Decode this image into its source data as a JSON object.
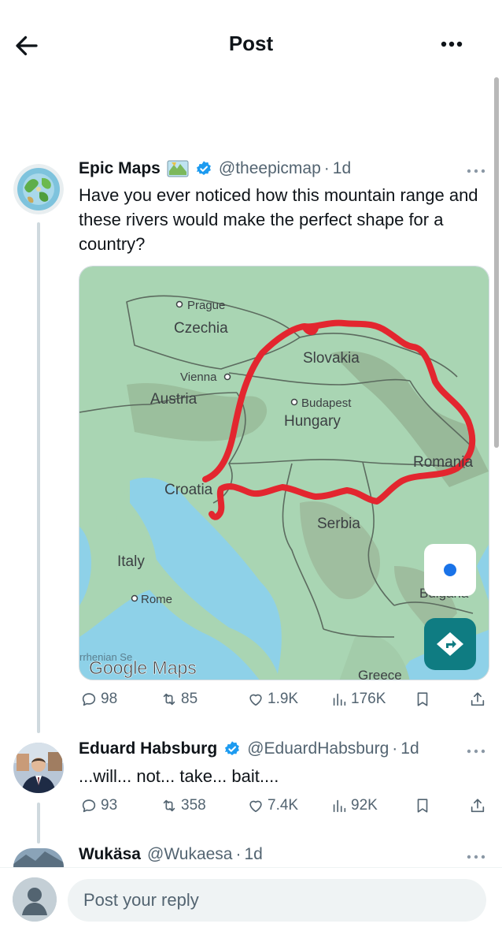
{
  "header": {
    "title": "Post"
  },
  "posts": [
    {
      "name": "Epic Maps",
      "handle": "@theepicmap",
      "separator": "·",
      "time": "1d",
      "text": "Have you ever noticed how this mountain range and these rivers would make the perfect shape for a country?",
      "media": {
        "labels": {
          "prague": "Prague",
          "czechia": "Czechia",
          "vienna": "Vienna",
          "austria": "Austria",
          "slovakia": "Slovakia",
          "budapest": "Budapest",
          "hungary": "Hungary",
          "romania": "Romania",
          "croatia": "Croatia",
          "serbia": "Serbia",
          "italy": "Italy",
          "rome": "Rome",
          "tyrrhenian": "rrhenian Se",
          "bulgaria": "Bulgaria",
          "greece": "Greece",
          "attribution": "Google Maps"
        }
      },
      "stats": {
        "replies": "98",
        "reposts": "85",
        "likes": "1.9K",
        "views": "176K"
      }
    },
    {
      "name": "Eduard Habsburg",
      "handle": "@EduardHabsburg",
      "separator": "·",
      "time": "1d",
      "text": "...will... not... take... bait....",
      "stats": {
        "replies": "93",
        "reposts": "358",
        "likes": "7.4K",
        "views": "92K"
      }
    },
    {
      "name": "Wukäsa",
      "handle": "@Wukaesa",
      "separator": "·",
      "time": "1d"
    }
  ],
  "reply": {
    "placeholder": "Post your reply"
  },
  "colors": {
    "verified": "#1d9bf0",
    "text": "#0f1419",
    "muted": "#536471",
    "route": "#e3262f"
  },
  "icons": [
    "back-arrow-icon",
    "more-icon",
    "verified-icon",
    "map-flag-icon",
    "reply-icon",
    "repost-icon",
    "like-icon",
    "views-icon",
    "bookmark-icon",
    "share-icon"
  ]
}
